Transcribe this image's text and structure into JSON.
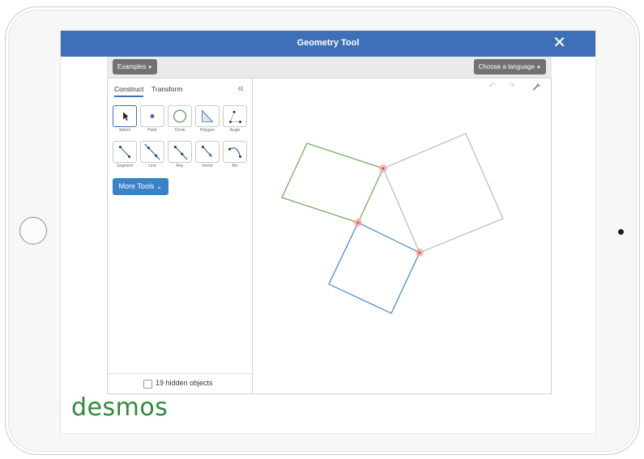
{
  "window": {
    "title": "Geometry Tool",
    "close_glyph": "✕"
  },
  "toolbar": {
    "examples_label": "Examples",
    "language_label": "Choose a language",
    "caret": "▼"
  },
  "panel": {
    "tabs": [
      {
        "label": "Construct",
        "active": true
      },
      {
        "label": "Transform",
        "active": false
      }
    ],
    "collapse_glyph": "«",
    "tools": [
      {
        "label": "Select",
        "icon": "cursor-icon",
        "selected": true
      },
      {
        "label": "Point",
        "icon": "point-icon",
        "selected": false
      },
      {
        "label": "Circle",
        "icon": "circle-icon",
        "selected": false
      },
      {
        "label": "Polygon",
        "icon": "polygon-icon",
        "selected": false
      },
      {
        "label": "Angle",
        "icon": "angle-icon",
        "selected": false
      },
      {
        "label": "Segment",
        "icon": "segment-icon",
        "selected": false
      },
      {
        "label": "Line",
        "icon": "line-icon",
        "selected": false
      },
      {
        "label": "Ray",
        "icon": "ray-icon",
        "selected": false
      },
      {
        "label": "Vector",
        "icon": "vector-icon",
        "selected": false
      },
      {
        "label": "Arc",
        "icon": "arc-icon",
        "selected": false
      }
    ],
    "more_tools_label": "More Tools",
    "more_tools_glyph": "⌄",
    "hidden_objects_label": "19 hidden objects",
    "hidden_objects_checked": false
  },
  "canvas": {
    "undo_glyph": "↶",
    "redo_glyph": "↷",
    "settings_icon": "wrench-icon"
  },
  "colors": {
    "titlebar": "#3f6fb9",
    "square_green": "#6aa84f",
    "square_gray": "#b8b8b8",
    "square_blue": "#3d85c6",
    "point_highlight": "#f4a6a6",
    "logo_green": "#2f8a3a"
  },
  "branding": {
    "logo_text": "desmos"
  }
}
